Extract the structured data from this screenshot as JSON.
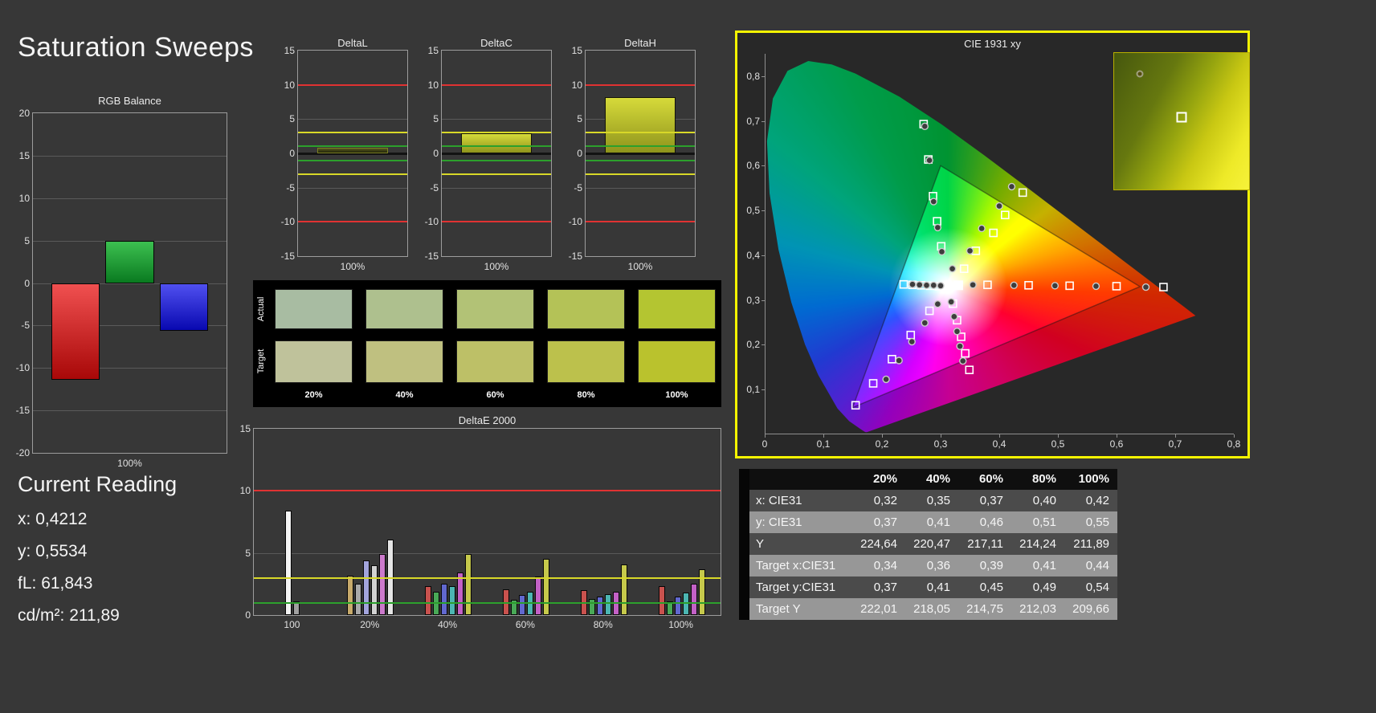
{
  "page_title": "Saturation Sweeps",
  "colors": {
    "background": "#373737",
    "highlight_border": "#f5f500",
    "reference_red": "#e03232",
    "reference_yellow": "#d8d828",
    "reference_green": "#2ca02c"
  },
  "current_reading": {
    "title": "Current Reading",
    "lines": [
      {
        "label": "x:",
        "value": "0,4212"
      },
      {
        "label": "y:",
        "value": "0,5534"
      },
      {
        "label": "fL:",
        "value": "61,843"
      },
      {
        "label": "cd/m²:",
        "value": "211,89"
      }
    ]
  },
  "swatches": {
    "row_labels": [
      "Actual",
      "Target"
    ],
    "column_labels": [
      "20%",
      "40%",
      "60%",
      "80%",
      "100%"
    ],
    "actual_colors": [
      "#a8bca2",
      "#aec08e",
      "#b2c276",
      "#b4c257",
      "#b4c531"
    ],
    "target_colors": [
      "#bfc29b",
      "#bfc080",
      "#bdc067",
      "#bcc14c",
      "#bac22d"
    ]
  },
  "chart_data": [
    {
      "id": "rgb_balance",
      "type": "bar",
      "title": "RGB Balance",
      "xlabel": "100%",
      "ylim": [
        -20,
        20
      ],
      "yticks": [
        20,
        15,
        10,
        5,
        0,
        -5,
        -10,
        -15,
        -20
      ],
      "categories": [
        "red",
        "green",
        "blue"
      ],
      "values": [
        -11.4,
        5.0,
        -5.6
      ],
      "bar_top_colors": [
        "#f05050",
        "#3cc050",
        "#5050f0"
      ],
      "bar_bottom_colors": [
        "#a80808",
        "#0a7a20",
        "#0808b0"
      ]
    },
    {
      "id": "delta_l",
      "type": "bar",
      "title": "DeltaL",
      "xlabel": "100%",
      "ylim": [
        -15,
        15
      ],
      "yticks": [
        15,
        10,
        5,
        0,
        -5,
        -10,
        -15
      ],
      "values": [
        0.8
      ],
      "bar_top": "#55591f",
      "bar_bottom": "#22240a",
      "bar_border": "#7a7f22",
      "reference_lines": [
        {
          "y": 10,
          "color": "#e03232"
        },
        {
          "y": 3,
          "color": "#d8d828"
        },
        {
          "y": 1,
          "color": "#2ca02c"
        },
        {
          "y": -1,
          "color": "#2ca02c"
        },
        {
          "y": -3,
          "color": "#d8d828"
        },
        {
          "y": -10,
          "color": "#e03232"
        }
      ]
    },
    {
      "id": "delta_c",
      "type": "bar",
      "title": "DeltaC",
      "xlabel": "100%",
      "ylim": [
        -15,
        15
      ],
      "yticks": [
        15,
        10,
        5,
        0,
        -5,
        -10,
        -15
      ],
      "values": [
        2.9
      ],
      "bar_top": "#d6da3a",
      "bar_bottom": "#8f941c",
      "bar_border": "#14140a",
      "reference_lines": [
        {
          "y": 10,
          "color": "#e03232"
        },
        {
          "y": 3,
          "color": "#d8d828"
        },
        {
          "y": 1,
          "color": "#2ca02c"
        },
        {
          "y": -1,
          "color": "#2ca02c"
        },
        {
          "y": -3,
          "color": "#d8d828"
        },
        {
          "y": -10,
          "color": "#e03232"
        }
      ]
    },
    {
      "id": "delta_h",
      "type": "bar",
      "title": "DeltaH",
      "xlabel": "100%",
      "ylim": [
        -15,
        15
      ],
      "yticks": [
        15,
        10,
        5,
        0,
        -5,
        -10,
        -15
      ],
      "values": [
        8.2
      ],
      "bar_top": "#d6da3a",
      "bar_bottom": "#8f941c",
      "bar_border": "#14140a",
      "reference_lines": [
        {
          "y": 10,
          "color": "#e03232"
        },
        {
          "y": 3,
          "color": "#d8d828"
        },
        {
          "y": 1,
          "color": "#2ca02c"
        },
        {
          "y": -1,
          "color": "#2ca02c"
        },
        {
          "y": -3,
          "color": "#d8d828"
        },
        {
          "y": -10,
          "color": "#e03232"
        }
      ]
    },
    {
      "id": "delta_e_2000",
      "type": "bar",
      "title": "DeltaE 2000",
      "ylim": [
        0,
        15
      ],
      "yticks": [
        15,
        10,
        5,
        0
      ],
      "reference_lines": [
        {
          "y": 10,
          "color": "#e03232"
        },
        {
          "y": 3,
          "color": "#d8d828"
        },
        {
          "y": 1,
          "color": "#2ca02c"
        }
      ],
      "groups": [
        {
          "label": "100",
          "values": [
            8.4,
            1.1
          ],
          "colors": [
            "#f4f4f4",
            "#a0a0a0"
          ]
        },
        {
          "label": "20%",
          "values": [
            3.2,
            2.5,
            4.4,
            4.0,
            4.9,
            6.1
          ],
          "colors": [
            "#c7aa6b",
            "#a9a9a9",
            "#a2a4dc",
            "#d2d2d2",
            "#cb79cb",
            "#e5e5e5"
          ]
        },
        {
          "label": "40%",
          "values": [
            2.3,
            1.9,
            2.5,
            2.3,
            3.4,
            4.9
          ],
          "colors": [
            "#c9524e",
            "#49a957",
            "#6168cf",
            "#4cb6b2",
            "#c361c6",
            "#c6c94b"
          ]
        },
        {
          "label": "60%",
          "values": [
            2.1,
            1.2,
            1.6,
            1.9,
            3.1,
            4.5
          ],
          "colors": [
            "#c9524e",
            "#49a957",
            "#6168cf",
            "#4cb6b2",
            "#c361c6",
            "#c6c94b"
          ]
        },
        {
          "label": "80%",
          "values": [
            2.0,
            1.3,
            1.5,
            1.7,
            1.9,
            4.1
          ],
          "colors": [
            "#c9524e",
            "#49a957",
            "#6168cf",
            "#4cb6b2",
            "#c361c6",
            "#c6c94b"
          ]
        },
        {
          "label": "100%",
          "values": [
            2.3,
            1.1,
            1.5,
            1.8,
            2.5,
            3.7
          ],
          "colors": [
            "#c9524e",
            "#49a957",
            "#6168cf",
            "#4cb6b2",
            "#c361c6",
            "#c6c94b"
          ]
        }
      ]
    },
    {
      "id": "cie_1931_xy",
      "type": "scatter",
      "title": "CIE 1931 xy",
      "xlim": [
        0,
        0.8
      ],
      "ylim": [
        0,
        0.85
      ],
      "xticks": [
        0,
        0.1,
        0.2,
        0.3,
        0.4,
        0.5,
        0.6,
        0.7,
        0.8
      ],
      "xtick_labels": [
        "0",
        "0,1",
        "0,2",
        "0,3",
        "0,4",
        "0,5",
        "0,6",
        "0,7",
        "0,8"
      ],
      "yticks": [
        0.1,
        0.2,
        0.3,
        0.4,
        0.5,
        0.6,
        0.7,
        0.8
      ],
      "ytick_labels": [
        "0,1",
        "0,2",
        "0,3",
        "0,4",
        "0,5",
        "0,6",
        "0,7",
        "0,8"
      ],
      "white_point": [
        0.313,
        0.329
      ],
      "current_marker": [
        0.33,
        0.333
      ],
      "gamut_triangle": [
        [
          0.64,
          0.33
        ],
        [
          0.3,
          0.6
        ],
        [
          0.15,
          0.06
        ]
      ],
      "spectral_locus": [
        [
          0.1741,
          0.005
        ],
        [
          0.1714,
          0.0051
        ],
        [
          0.1644,
          0.0109
        ],
        [
          0.144,
          0.0297
        ],
        [
          0.1241,
          0.0578
        ],
        [
          0.0913,
          0.1327
        ],
        [
          0.0687,
          0.2007
        ],
        [
          0.0454,
          0.295
        ],
        [
          0.0235,
          0.4127
        ],
        [
          0.0082,
          0.5384
        ],
        [
          0.0039,
          0.6548
        ],
        [
          0.0139,
          0.7502
        ],
        [
          0.0389,
          0.812
        ],
        [
          0.0743,
          0.8338
        ],
        [
          0.1142,
          0.8262
        ],
        [
          0.1547,
          0.8059
        ],
        [
          0.2296,
          0.7543
        ],
        [
          0.3016,
          0.6923
        ],
        [
          0.3731,
          0.6245
        ],
        [
          0.4441,
          0.5547
        ],
        [
          0.5125,
          0.4866
        ],
        [
          0.5752,
          0.4242
        ],
        [
          0.627,
          0.3725
        ],
        [
          0.6658,
          0.334
        ],
        [
          0.6915,
          0.3083
        ],
        [
          0.714,
          0.2859
        ],
        [
          0.7347,
          0.2653
        ]
      ],
      "measured_points": [
        [
          0.355,
          0.334
        ],
        [
          0.425,
          0.333
        ],
        [
          0.495,
          0.332
        ],
        [
          0.565,
          0.331
        ],
        [
          0.65,
          0.329
        ],
        [
          0.302,
          0.408
        ],
        [
          0.295,
          0.462
        ],
        [
          0.288,
          0.52
        ],
        [
          0.281,
          0.612
        ],
        [
          0.273,
          0.688
        ],
        [
          0.32,
          0.37
        ],
        [
          0.35,
          0.41
        ],
        [
          0.37,
          0.46
        ],
        [
          0.4,
          0.51
        ],
        [
          0.4212,
          0.5534
        ],
        [
          0.3,
          0.332
        ],
        [
          0.288,
          0.333
        ],
        [
          0.276,
          0.333
        ],
        [
          0.264,
          0.334
        ],
        [
          0.252,
          0.335
        ],
        [
          0.295,
          0.291
        ],
        [
          0.273,
          0.249
        ],
        [
          0.251,
          0.207
        ],
        [
          0.229,
          0.165
        ],
        [
          0.207,
          0.123
        ],
        [
          0.318,
          0.296
        ],
        [
          0.323,
          0.263
        ],
        [
          0.328,
          0.23
        ],
        [
          0.333,
          0.197
        ],
        [
          0.338,
          0.164
        ]
      ],
      "target_points": [
        [
          0.38,
          0.334
        ],
        [
          0.45,
          0.333
        ],
        [
          0.52,
          0.332
        ],
        [
          0.6,
          0.331
        ],
        [
          0.68,
          0.329
        ],
        [
          0.301,
          0.42
        ],
        [
          0.294,
          0.476
        ],
        [
          0.287,
          0.532
        ],
        [
          0.279,
          0.614
        ],
        [
          0.271,
          0.693
        ],
        [
          0.34,
          0.37
        ],
        [
          0.36,
          0.41
        ],
        [
          0.39,
          0.45
        ],
        [
          0.41,
          0.49
        ],
        [
          0.44,
          0.54
        ],
        [
          0.297,
          0.331
        ],
        [
          0.282,
          0.332
        ],
        [
          0.267,
          0.333
        ],
        [
          0.252,
          0.334
        ],
        [
          0.237,
          0.335
        ],
        [
          0.281,
          0.276
        ],
        [
          0.249,
          0.222
        ],
        [
          0.217,
          0.168
        ],
        [
          0.185,
          0.114
        ],
        [
          0.155,
          0.065
        ],
        [
          0.321,
          0.292
        ],
        [
          0.328,
          0.255
        ],
        [
          0.335,
          0.218
        ],
        [
          0.342,
          0.181
        ],
        [
          0.349,
          0.144
        ]
      ],
      "inset": {
        "circle_point": [
          0.19,
          0.15
        ],
        "square_point": [
          0.5,
          0.47
        ]
      }
    },
    {
      "id": "saturation_table",
      "type": "table",
      "column_headers": [
        "20%",
        "40%",
        "60%",
        "80%",
        "100%"
      ],
      "rows": [
        {
          "label": "x: CIE31",
          "values": [
            "0,32",
            "0,35",
            "0,37",
            "0,40",
            "0,42"
          ]
        },
        {
          "label": "y: CIE31",
          "values": [
            "0,37",
            "0,41",
            "0,46",
            "0,51",
            "0,55"
          ]
        },
        {
          "label": "Y",
          "values": [
            "224,64",
            "220,47",
            "217,11",
            "214,24",
            "211,89"
          ]
        },
        {
          "label": "Target x:CIE31",
          "values": [
            "0,34",
            "0,36",
            "0,39",
            "0,41",
            "0,44"
          ]
        },
        {
          "label": "Target y:CIE31",
          "values": [
            "0,37",
            "0,41",
            "0,45",
            "0,49",
            "0,54"
          ]
        },
        {
          "label": "Target Y",
          "values": [
            "222,01",
            "218,05",
            "214,75",
            "212,03",
            "209,66"
          ]
        }
      ]
    }
  ]
}
